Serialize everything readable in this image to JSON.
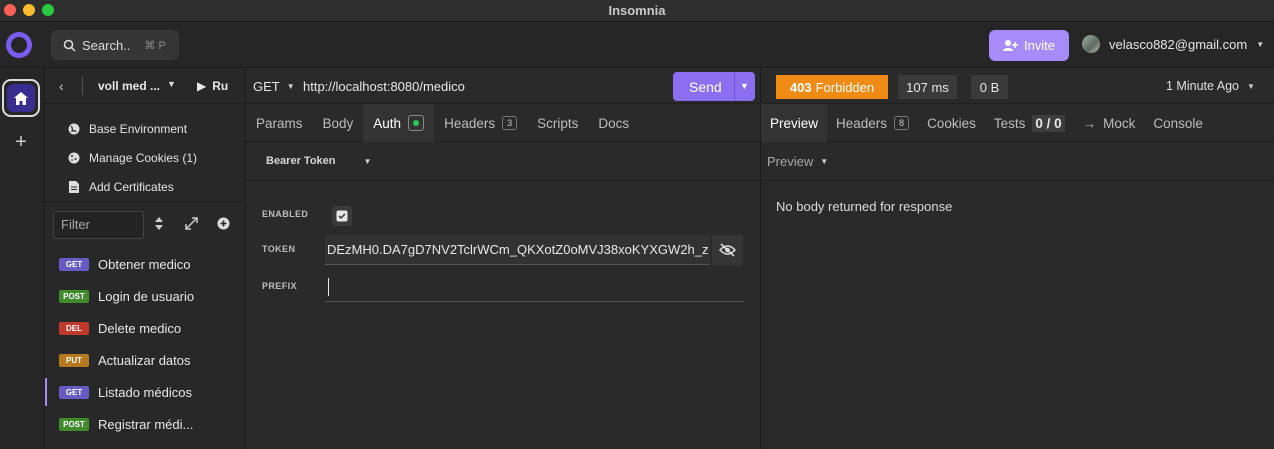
{
  "window": {
    "title": "Insomnia"
  },
  "header": {
    "search_label": "Search..",
    "search_shortcut": "⌘ P",
    "invite_label": "Invite",
    "user_email": "velasco882@gmail.com"
  },
  "sidebar": {
    "project_name": "voll med ...",
    "run_label": "Ru",
    "menu": [
      {
        "label": "Base Environment",
        "icon": "globe-icon"
      },
      {
        "label": "Manage Cookies (1)",
        "icon": "cookie-icon"
      },
      {
        "label": "Add Certificates",
        "icon": "certificate-icon"
      }
    ],
    "filter_placeholder": "Filter",
    "requests": [
      {
        "method": "GET",
        "name": "Obtener medico",
        "color": "#6a5bc4"
      },
      {
        "method": "POST",
        "name": "Login de usuario",
        "color": "#3f8b2e"
      },
      {
        "method": "DEL",
        "name": "Delete medico",
        "color": "#c0392b"
      },
      {
        "method": "PUT",
        "name": "Actualizar datos",
        "color": "#b7791f"
      },
      {
        "method": "GET",
        "name": "Listado médicos",
        "color": "#6a5bc4"
      },
      {
        "method": "POST",
        "name": "Registrar médi...",
        "color": "#3f8b2e"
      }
    ]
  },
  "request": {
    "method": "GET",
    "url": "http://localhost:8080/medico",
    "send_label": "Send",
    "tabs": [
      {
        "label": "Params"
      },
      {
        "label": "Body"
      },
      {
        "label": "Auth"
      },
      {
        "label": "Headers",
        "count": "3"
      },
      {
        "label": "Scripts"
      },
      {
        "label": "Docs"
      }
    ],
    "auth_type": "Bearer Token",
    "auth": {
      "enabled_label": "ENABLED",
      "enabled": true,
      "token_label": "TOKEN",
      "token_value": "DEzMH0.DA7gD7NV2TclrWCm_QKXotZ0oMVJ38xoKYXGW2h_z",
      "prefix_label": "PREFIX",
      "prefix_value": ""
    }
  },
  "response": {
    "status_code": "403",
    "status_text": "Forbidden",
    "status_color": "#f08c16",
    "time": "107 ms",
    "size": "0 B",
    "history": "1 Minute Ago",
    "tabs": [
      {
        "label": "Preview"
      },
      {
        "label": "Headers",
        "count": "8"
      },
      {
        "label": "Cookies"
      },
      {
        "label": "Tests",
        "count": "0 / 0"
      },
      {
        "label": "Mock"
      },
      {
        "label": "Console"
      }
    ],
    "preview_mode": "Preview",
    "body_message": "No body returned for response"
  }
}
